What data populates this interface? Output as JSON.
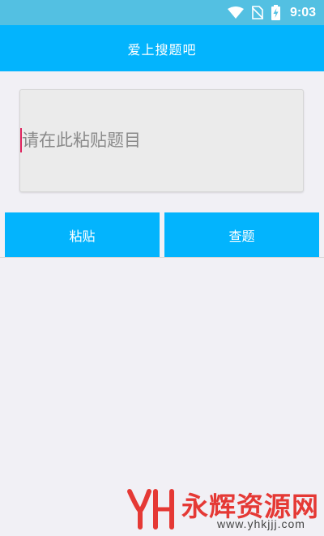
{
  "status_bar": {
    "time": "9:03",
    "icons": [
      "wifi-icon",
      "no-sim-icon",
      "battery-charging-icon"
    ]
  },
  "app_bar": {
    "title": "爱上搜题吧"
  },
  "question_input": {
    "placeholder": "请在此粘贴题目",
    "value": ""
  },
  "actions": {
    "paste_label": "粘贴",
    "search_label": "查题"
  },
  "watermark": {
    "title": "永辉资源网",
    "url": "www.yhkjjj.com"
  },
  "colors": {
    "status_bar": "#53c0e2",
    "accent": "#03b4fd",
    "background": "#f1f0f5",
    "input_background": "#ebebeb",
    "cursor": "#e0245e",
    "watermark": "#e53935"
  }
}
